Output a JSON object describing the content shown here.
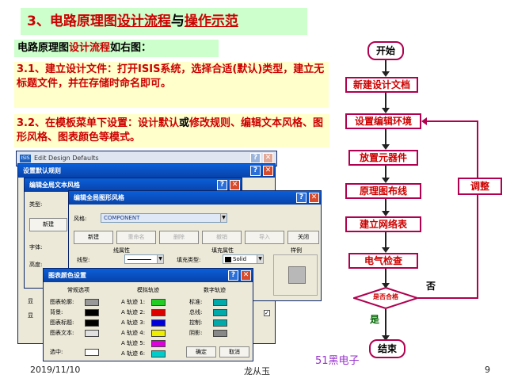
{
  "slide": {
    "title_num": "3、",
    "title_a": "电路原理图",
    "title_b": "设计流程",
    "title_c": "与",
    "title_d": "操作示范",
    "intro_a": "电路原理图",
    "intro_b": "设计流程",
    "intro_c": "如右图：",
    "p31": "3.1、建立设计文件：打开ISIS系统，选择合适(默认)类型，建立无标题文件，并在存储时命名即可。",
    "p32_a": "3.2、在模板菜单下设置：设计默认",
    "p32_b": "或",
    "p32_c": "修改规则、编辑文本风格、图形风格、图表颜色等模式。",
    "date": "2019/11/10",
    "author": "龙从玉",
    "watermark": "51黑电子",
    "page": "9"
  },
  "windows": {
    "edit_defaults_title": "Edit Design Defaults",
    "design_default_title": "设置默认规则",
    "text_style_title": "编辑全局文本风格",
    "text_style": {
      "type_label": "类型:",
      "new_btn": "新建",
      "font_label": "字体:",
      "height_label": "高度:"
    },
    "side_labels": [
      "图",
      "模",
      "工",
      "边",
      "离"
    ],
    "bottom_labels": [
      "显",
      "显"
    ],
    "graphic_style_title": "编辑全局图形风格",
    "graphic_style": {
      "style_label": "风格:",
      "style_value": "COMPONENT",
      "buttons": [
        "新建",
        "重命名",
        "删除",
        "撤销",
        "导入",
        "关闭"
      ],
      "line_attr": "线属性",
      "fill_attr": "填充属性",
      "sample": "样例",
      "line_type": "线型:",
      "fill_type": "填充类型:",
      "fill_value": "Solid"
    },
    "chart_colors_title": "图表颜色设置",
    "chart_colors": {
      "group1": "常规选项",
      "group2": "模拟轨迹",
      "group3": "数字轨迹",
      "g1_items": [
        "图表轮廓:",
        "背景:",
        "图表标题:",
        "图表文本:"
      ],
      "g1_select": "选中:",
      "g2_items": [
        "A 轨迹 1:",
        "A 轨迹 2:",
        "A 轨迹 3:",
        "A 轨迹 4:",
        "A 轨迹 5:",
        "A 轨迹 6:"
      ],
      "g3_items": [
        "标准:",
        "总线:",
        "控制:",
        "阴影:"
      ],
      "ok": "确定",
      "cancel": "取消"
    }
  },
  "flow": {
    "start": "开始",
    "steps": [
      "新建设计文档",
      "设置编辑环境",
      "放置元器件",
      "原理图布线",
      "建立网络表",
      "电气检查"
    ],
    "decision": "是否合格",
    "no": "否",
    "yes": "是",
    "adjust": "调整",
    "end": "结束"
  },
  "colors": {
    "accent_red": "#cc0000",
    "flow_border": "#b0004f",
    "title_bg": "#ccffcc",
    "para_bg": "#ffffcc"
  }
}
